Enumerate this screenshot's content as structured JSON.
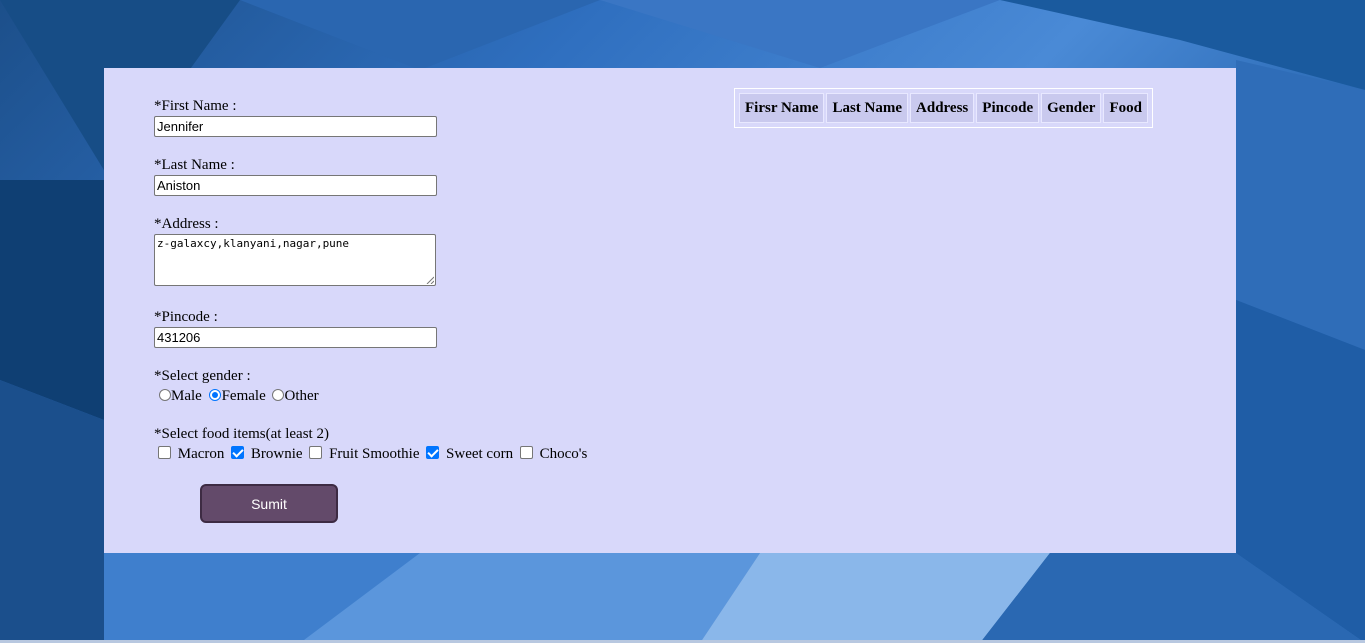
{
  "form": {
    "first_name": {
      "label": "*First Name :",
      "value": "Jennifer"
    },
    "last_name": {
      "label": "*Last Name :",
      "value": "Aniston"
    },
    "address": {
      "label": "*Address :",
      "value": "z-galaxcy,klanyani,nagar,pune"
    },
    "pincode": {
      "label": "*Pincode :",
      "value": "431206"
    },
    "gender": {
      "label": "*Select gender :",
      "options": [
        {
          "label": "Male",
          "checked": false
        },
        {
          "label": "Female",
          "checked": true
        },
        {
          "label": "Other",
          "checked": false
        }
      ]
    },
    "food": {
      "label": "*Select food items(at least 2)",
      "options": [
        {
          "label": "Macron",
          "checked": false
        },
        {
          "label": "Brownie",
          "checked": true
        },
        {
          "label": "Fruit Smoothie",
          "checked": false
        },
        {
          "label": "Sweet corn",
          "checked": true
        },
        {
          "label": "Choco's",
          "checked": false
        }
      ]
    },
    "submit_label": "Sumit"
  },
  "table": {
    "headers": [
      "Firsr Name",
      "Last Name",
      "Address",
      "Pincode",
      "Gender",
      "Food"
    ]
  },
  "colors": {
    "panel": "#d8d8fa",
    "button": "#634a6a",
    "accent": "#0075ff"
  }
}
